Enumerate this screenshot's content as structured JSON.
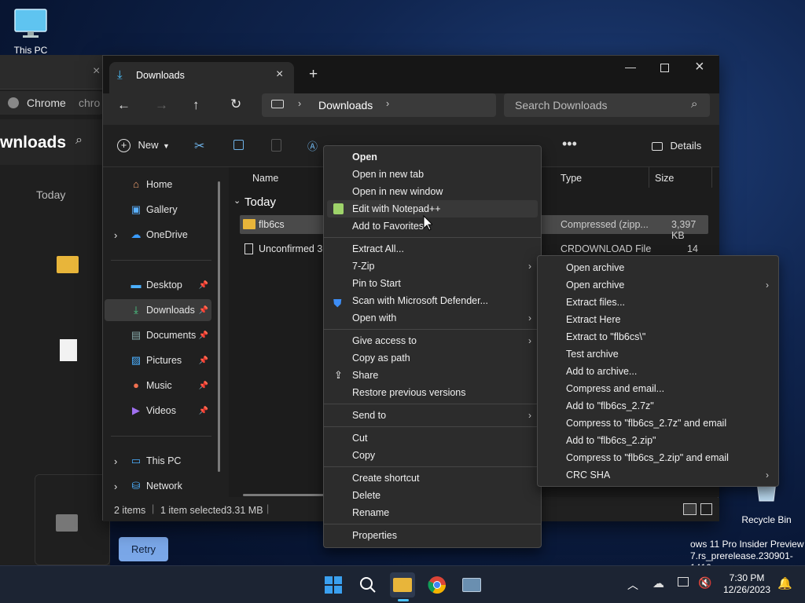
{
  "desktop": {
    "this_pc": "This PC",
    "recycle_bin": "Recycle Bin",
    "watermark_line1": "ows 11 Pro Insider Preview",
    "watermark_line2": "7.rs_prerelease.230901-1416"
  },
  "background_window": {
    "browser_label": "Chrome",
    "address_text": "chro",
    "heading": "wnloads",
    "today": "Today",
    "retry": "Retry"
  },
  "explorer": {
    "tab_title": "Downloads",
    "address_crumb": "Downloads",
    "search_placeholder": "Search Downloads",
    "toolbar": {
      "new": "New",
      "details": "Details"
    },
    "sidebar": [
      {
        "label": "Home",
        "icon": "home-icon"
      },
      {
        "label": "Gallery",
        "icon": "gallery-icon"
      },
      {
        "label": "OneDrive",
        "icon": "cloud-icon"
      },
      {
        "label": "Desktop",
        "icon": "desktop-icon"
      },
      {
        "label": "Downloads",
        "icon": "download-icon"
      },
      {
        "label": "Documents",
        "icon": "documents-icon"
      },
      {
        "label": "Pictures",
        "icon": "pictures-icon"
      },
      {
        "label": "Music",
        "icon": "music-icon"
      },
      {
        "label": "Videos",
        "icon": "videos-icon"
      },
      {
        "label": "This PC",
        "icon": "pc-icon"
      },
      {
        "label": "Network",
        "icon": "network-icon"
      }
    ],
    "columns": {
      "name": "Name",
      "type": "Type",
      "size": "Size"
    },
    "group": "Today",
    "files": [
      {
        "name": "flb6cs",
        "type": "Compressed (zipp...",
        "size": "3,397 KB"
      },
      {
        "name": "Unconfirmed 36",
        "type": "CRDOWNLOAD File",
        "size": "14 KB"
      }
    ],
    "status": {
      "count": "2 items",
      "selected": "1 item selected",
      "size": "3.31 MB"
    }
  },
  "context_menu": [
    "Open",
    "Open in new tab",
    "Open in new window",
    "Edit with Notepad++",
    "Add to Favorites",
    "Extract All...",
    "7-Zip",
    "Pin to Start",
    "Scan with Microsoft Defender...",
    "Open with",
    "Give access to",
    "Copy as path",
    "Share",
    "Restore previous versions",
    "Send to",
    "Cut",
    "Copy",
    "Create shortcut",
    "Delete",
    "Rename",
    "Properties"
  ],
  "submenu": [
    "Open archive",
    "Open archive",
    "Extract files...",
    "Extract Here",
    "Extract to \"flb6cs\\\"",
    "Test archive",
    "Add to archive...",
    "Compress and email...",
    "Add to \"flb6cs_2.7z\"",
    "Compress to \"flb6cs_2.7z\" and email",
    "Add to \"flb6cs_2.zip\"",
    "Compress to \"flb6cs_2.zip\" and email",
    "CRC SHA"
  ],
  "taskbar": {
    "time": "7:30 PM",
    "date": "12/26/2023"
  },
  "colors": {
    "accent": "#4cc2ff",
    "folder": "#e8b53a",
    "retry": "#7aa7e8"
  }
}
